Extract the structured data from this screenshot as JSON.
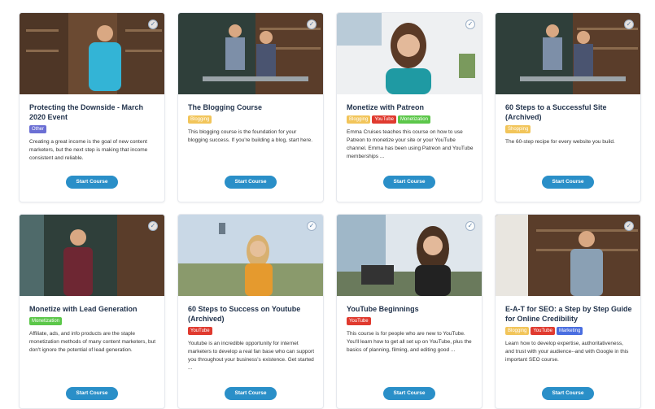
{
  "theme": {
    "button_color": "#2a8fc8",
    "tag_colors": {
      "Other": "#6b6fd4",
      "Blogging": "#f2c55a",
      "YouTube": "#e03a2f",
      "Monetization": "#5cc74a",
      "Shopping": "#f2c55a",
      "Marketing": "#4a6ee0"
    }
  },
  "courses": [
    {
      "title": "Protecting the Downside - March 2020 Event",
      "tags": [
        "Other"
      ],
      "description": "Creating a great income is the goal of new content marketers, but the next step is making that income consistent and reliable.",
      "button": "Start Course"
    },
    {
      "title": "The Blogging Course",
      "tags": [
        "Blogging"
      ],
      "description": "This blogging course is the foundation for your blogging success. If you're building a blog, start here.",
      "button": "Start Course"
    },
    {
      "title": "Monetize with Patreon",
      "tags": [
        "Blogging",
        "YouTube",
        "Monetization"
      ],
      "description": "Emma Cruises teaches this course on how to use Patreon to monetize your site or your YouTube channel. Emma has been using Patreon and YouTube memberships ...",
      "button": "Start Course"
    },
    {
      "title": "60 Steps to a Successful Site (Archived)",
      "tags": [
        "Shopping"
      ],
      "description": "The 60-step recipe for every website you build.",
      "button": "Start Course"
    },
    {
      "title": "Monetize with Lead Generation",
      "tags": [
        "Monetization"
      ],
      "description": "Affiliate, ads, and info products are the staple monetization methods of many content marketers, but don't ignore the potential of lead generation.",
      "button": "Start Course"
    },
    {
      "title": "60 Steps to Success on Youtube (Archived)",
      "tags": [
        "YouTube"
      ],
      "description": "Youtube is an incredible opportunity for internet marketers to develop a real fan base who can support you throughout your business's existence. Get started ...",
      "button": "Start Course"
    },
    {
      "title": "YouTube Beginnings",
      "tags": [
        "YouTube"
      ],
      "description": "This course is for people who are new to YouTube. You'll learn how to get all set up on YouTube, plus the basics of planning, filming, and editing good ...",
      "button": "Start Course"
    },
    {
      "title": "E-A-T for SEO: a Step by Step Guide for Online Credibility",
      "tags": [
        "Blogging",
        "YouTube",
        "Marketing"
      ],
      "description": "Learn how to develop expertise, authoritativeness, and trust with your audience--and with Google in this important SEO course.",
      "button": "Start Course"
    }
  ]
}
